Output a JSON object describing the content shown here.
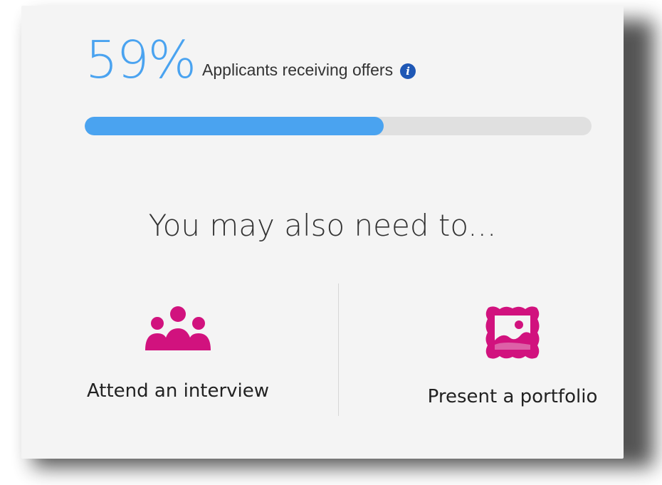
{
  "stat": {
    "percent_text": "59%",
    "label": "Applicants receiving offers",
    "progress": 0.59,
    "info_icon": "info-icon"
  },
  "section": {
    "heading": "You may also need to..."
  },
  "actions": [
    {
      "label": "Attend an interview",
      "icon": "group-icon"
    },
    {
      "label": "Present a portfolio",
      "icon": "portfolio-icon"
    }
  ],
  "colors": {
    "accent": "#4aa3f0",
    "track": "#e0e0e0",
    "icon_magenta": "#d1127e",
    "info_blue": "#1e57b5",
    "card_bg": "#f4f4f4"
  }
}
